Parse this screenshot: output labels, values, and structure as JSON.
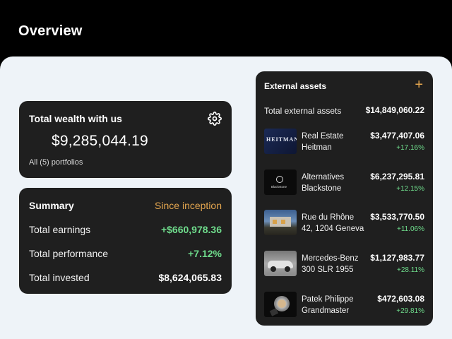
{
  "header": {
    "title": "Overview"
  },
  "wealth": {
    "title": "Total wealth with us",
    "amount": "$9,285,044.19",
    "subtitle": "All (5) portfolios",
    "currency_icon": "eu-flag-icon",
    "settings_icon": "gear-icon"
  },
  "summary": {
    "title": "Summary",
    "period": "Since inception",
    "rows": [
      {
        "label": "Total earnings",
        "value": "+$660,978.36",
        "positive": true
      },
      {
        "label": "Total performance",
        "value": "+7.12%",
        "positive": true
      },
      {
        "label": "Total invested",
        "value": "$8,624,065.83",
        "positive": false
      }
    ]
  },
  "external": {
    "title": "External assets",
    "add_icon": "plus-icon",
    "total_label": "Total external assets",
    "total_value": "$14,849,060.22",
    "assets": [
      {
        "line1": "Real Estate",
        "line2": "Heitman",
        "value": "$3,477,407.06",
        "change": "+17.16%",
        "thumb_text": "HEITMAN"
      },
      {
        "line1": "Alternatives",
        "line2": "Blackstone",
        "value": "$6,237,295.81",
        "change": "+12.15%",
        "thumb_text": "Blackstone"
      },
      {
        "line1": "Rue du Rhône",
        "line2": "42, 1204 Geneva",
        "value": "$3,533,770.50",
        "change": "+11.06%"
      },
      {
        "line1": "Mercedes-Benz",
        "line2": "300 SLR 1955",
        "value": "$1,127,983.77",
        "change": "+28.11%"
      },
      {
        "line1": "Patek Philippe",
        "line2": "Grandmaster",
        "value": "$472,603.08",
        "change": "+29.81%"
      }
    ]
  },
  "colors": {
    "accent": "#e4a64f",
    "positive": "#6fdc8c",
    "card": "#1f1f1f",
    "canvas": "#eef3f8"
  }
}
